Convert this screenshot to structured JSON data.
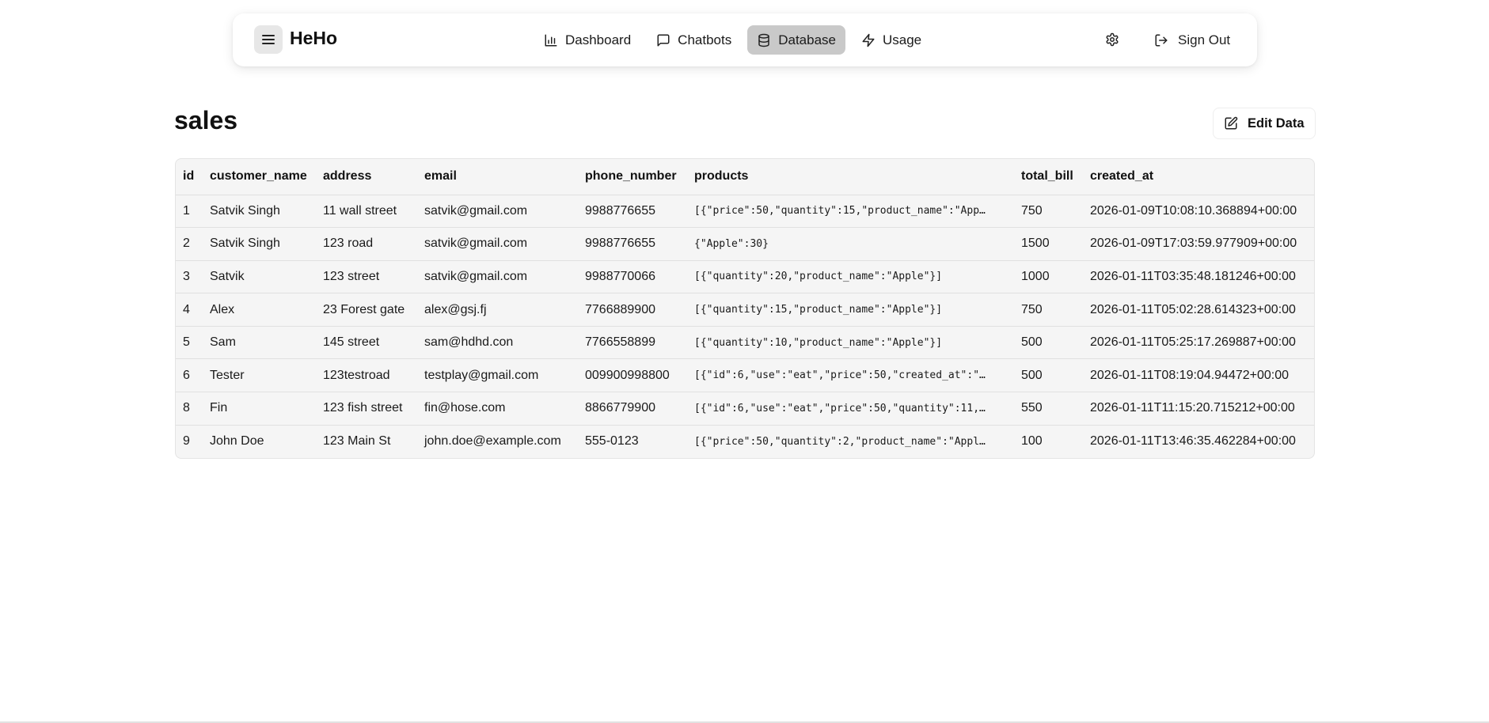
{
  "header": {
    "brand": "HeHo",
    "nav": [
      {
        "label": "Dashboard",
        "icon": "bar-chart-icon",
        "active": false
      },
      {
        "label": "Chatbots",
        "icon": "chat-bubble-icon",
        "active": false
      },
      {
        "label": "Database",
        "icon": "database-icon",
        "active": true
      },
      {
        "label": "Usage",
        "icon": "lightning-icon",
        "active": false
      }
    ],
    "settings_icon": "gear-icon",
    "sign_out_label": "Sign Out"
  },
  "main": {
    "table_name": "sales",
    "edit_label": "Edit Data",
    "columns": [
      "id",
      "customer_name",
      "address",
      "email",
      "phone_number",
      "products",
      "total_bill",
      "created_at"
    ],
    "rows": [
      [
        "1",
        "Satvik Singh",
        "11 wall street",
        "satvik@gmail.com",
        "9988776655",
        "[{\"price\":50,\"quantity\":15,\"product_name\":\"Appl…",
        "750",
        "2026-01-09T10:08:10.368894+00:00"
      ],
      [
        "2",
        "Satvik Singh",
        "123 road",
        "satvik@gmail.com",
        "9988776655",
        "{\"Apple\":30}",
        "1500",
        "2026-01-09T17:03:59.977909+00:00"
      ],
      [
        "3",
        "Satvik",
        "123 street",
        "satvik@gmail.com",
        "9988770066",
        "[{\"quantity\":20,\"product_name\":\"Apple\"}]",
        "1000",
        "2026-01-11T03:35:48.181246+00:00"
      ],
      [
        "4",
        "Alex",
        "23 Forest gate",
        "alex@gsj.fj",
        "7766889900",
        "[{\"quantity\":15,\"product_name\":\"Apple\"}]",
        "750",
        "2026-01-11T05:02:28.614323+00:00"
      ],
      [
        "5",
        "Sam",
        "145 street",
        "sam@hdhd.con",
        "7766558899",
        "[{\"quantity\":10,\"product_name\":\"Apple\"}]",
        "500",
        "2026-01-11T05:25:17.269887+00:00"
      ],
      [
        "6",
        "Tester",
        "123testroad",
        "testplay@gmail.com",
        "009900998800",
        "[{\"id\":6,\"use\":\"eat\",\"price\":50,\"created_at\":\"2…",
        "500",
        "2026-01-11T08:19:04.94472+00:00"
      ],
      [
        "8",
        "Fin",
        "123 fish street",
        "fin@hose.com",
        "8866779900",
        "[{\"id\":6,\"use\":\"eat\",\"price\":50,\"quantity\":11,\"…",
        "550",
        "2026-01-11T11:15:20.715212+00:00"
      ],
      [
        "9",
        "John Doe",
        "123 Main St",
        "john.doe@example.com",
        "555-0123",
        "[{\"price\":50,\"quantity\":2,\"product_name\":\"Apple…",
        "100",
        "2026-01-11T13:46:35.462284+00:00"
      ]
    ]
  }
}
